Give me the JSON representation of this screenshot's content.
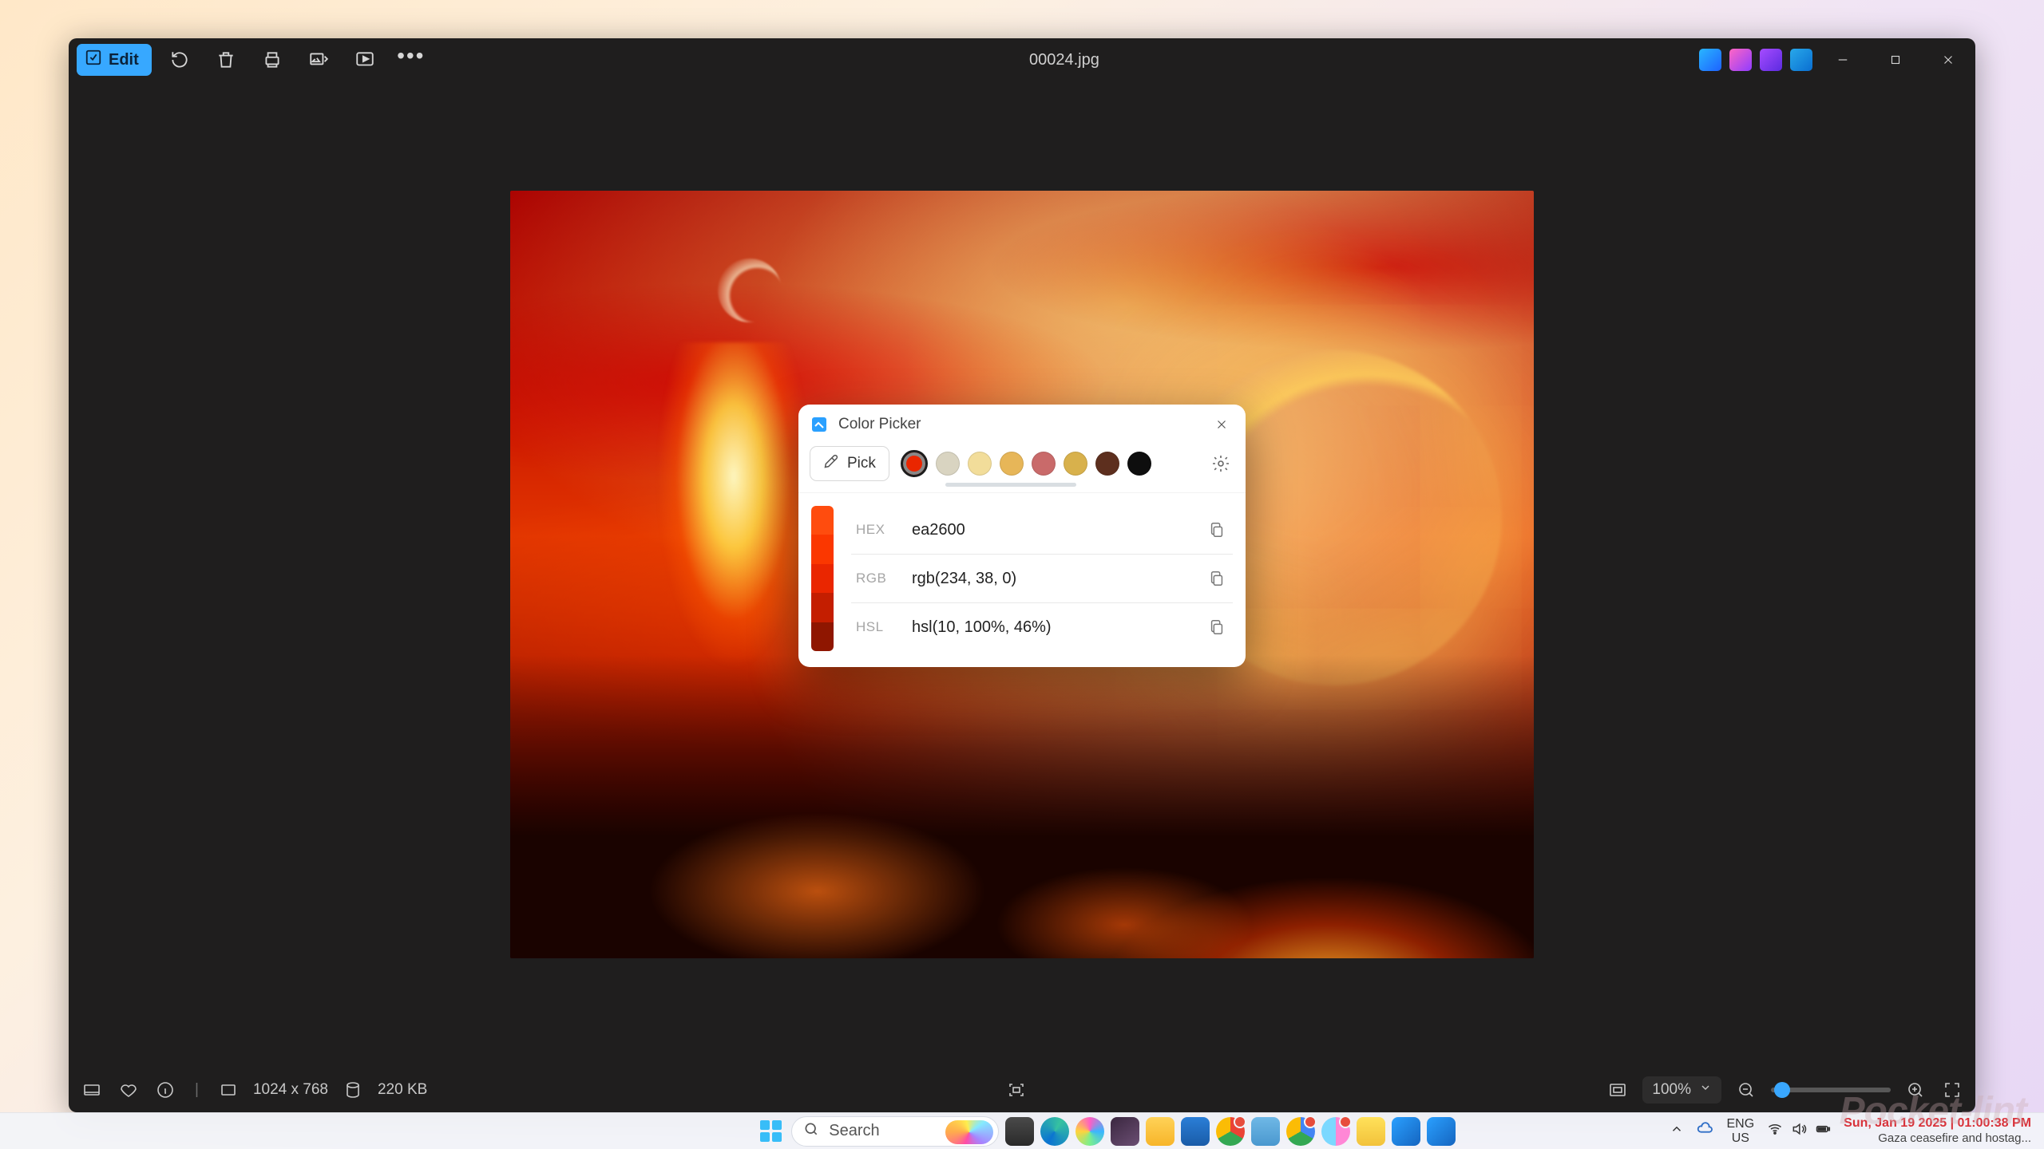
{
  "photos": {
    "title": "00024.jpg",
    "edit_label": "Edit",
    "status": {
      "dimensions": "1024 x 768",
      "filesize": "220 KB",
      "zoom": "100%"
    }
  },
  "color_picker": {
    "title": "Color Picker",
    "pick_label": "Pick",
    "swatches": [
      "#ea2600",
      "#d9d4c1",
      "#f2dd9a",
      "#e7b658",
      "#c96a6a",
      "#d8b14c",
      "#5d2f1e",
      "#0e0e0e"
    ],
    "shades": [
      "#ff4c0e",
      "#fb3700",
      "#ea2600",
      "#c41e00",
      "#8f1600"
    ],
    "formats": {
      "hex": {
        "label": "HEX",
        "value": "ea2600"
      },
      "rgb": {
        "label": "RGB",
        "value": "rgb(234, 38, 0)"
      },
      "hsl": {
        "label": "HSL",
        "value": "hsl(10, 100%, 46%)"
      }
    }
  },
  "taskbar": {
    "search_placeholder": "Search",
    "lang_top": "ENG",
    "lang_bottom": "US",
    "clock": "Sun, Jan 19 2025 | 01:00:38 PM",
    "headline": "Gaza ceasefire and hostag..."
  },
  "watermark": "Pocket-lint"
}
